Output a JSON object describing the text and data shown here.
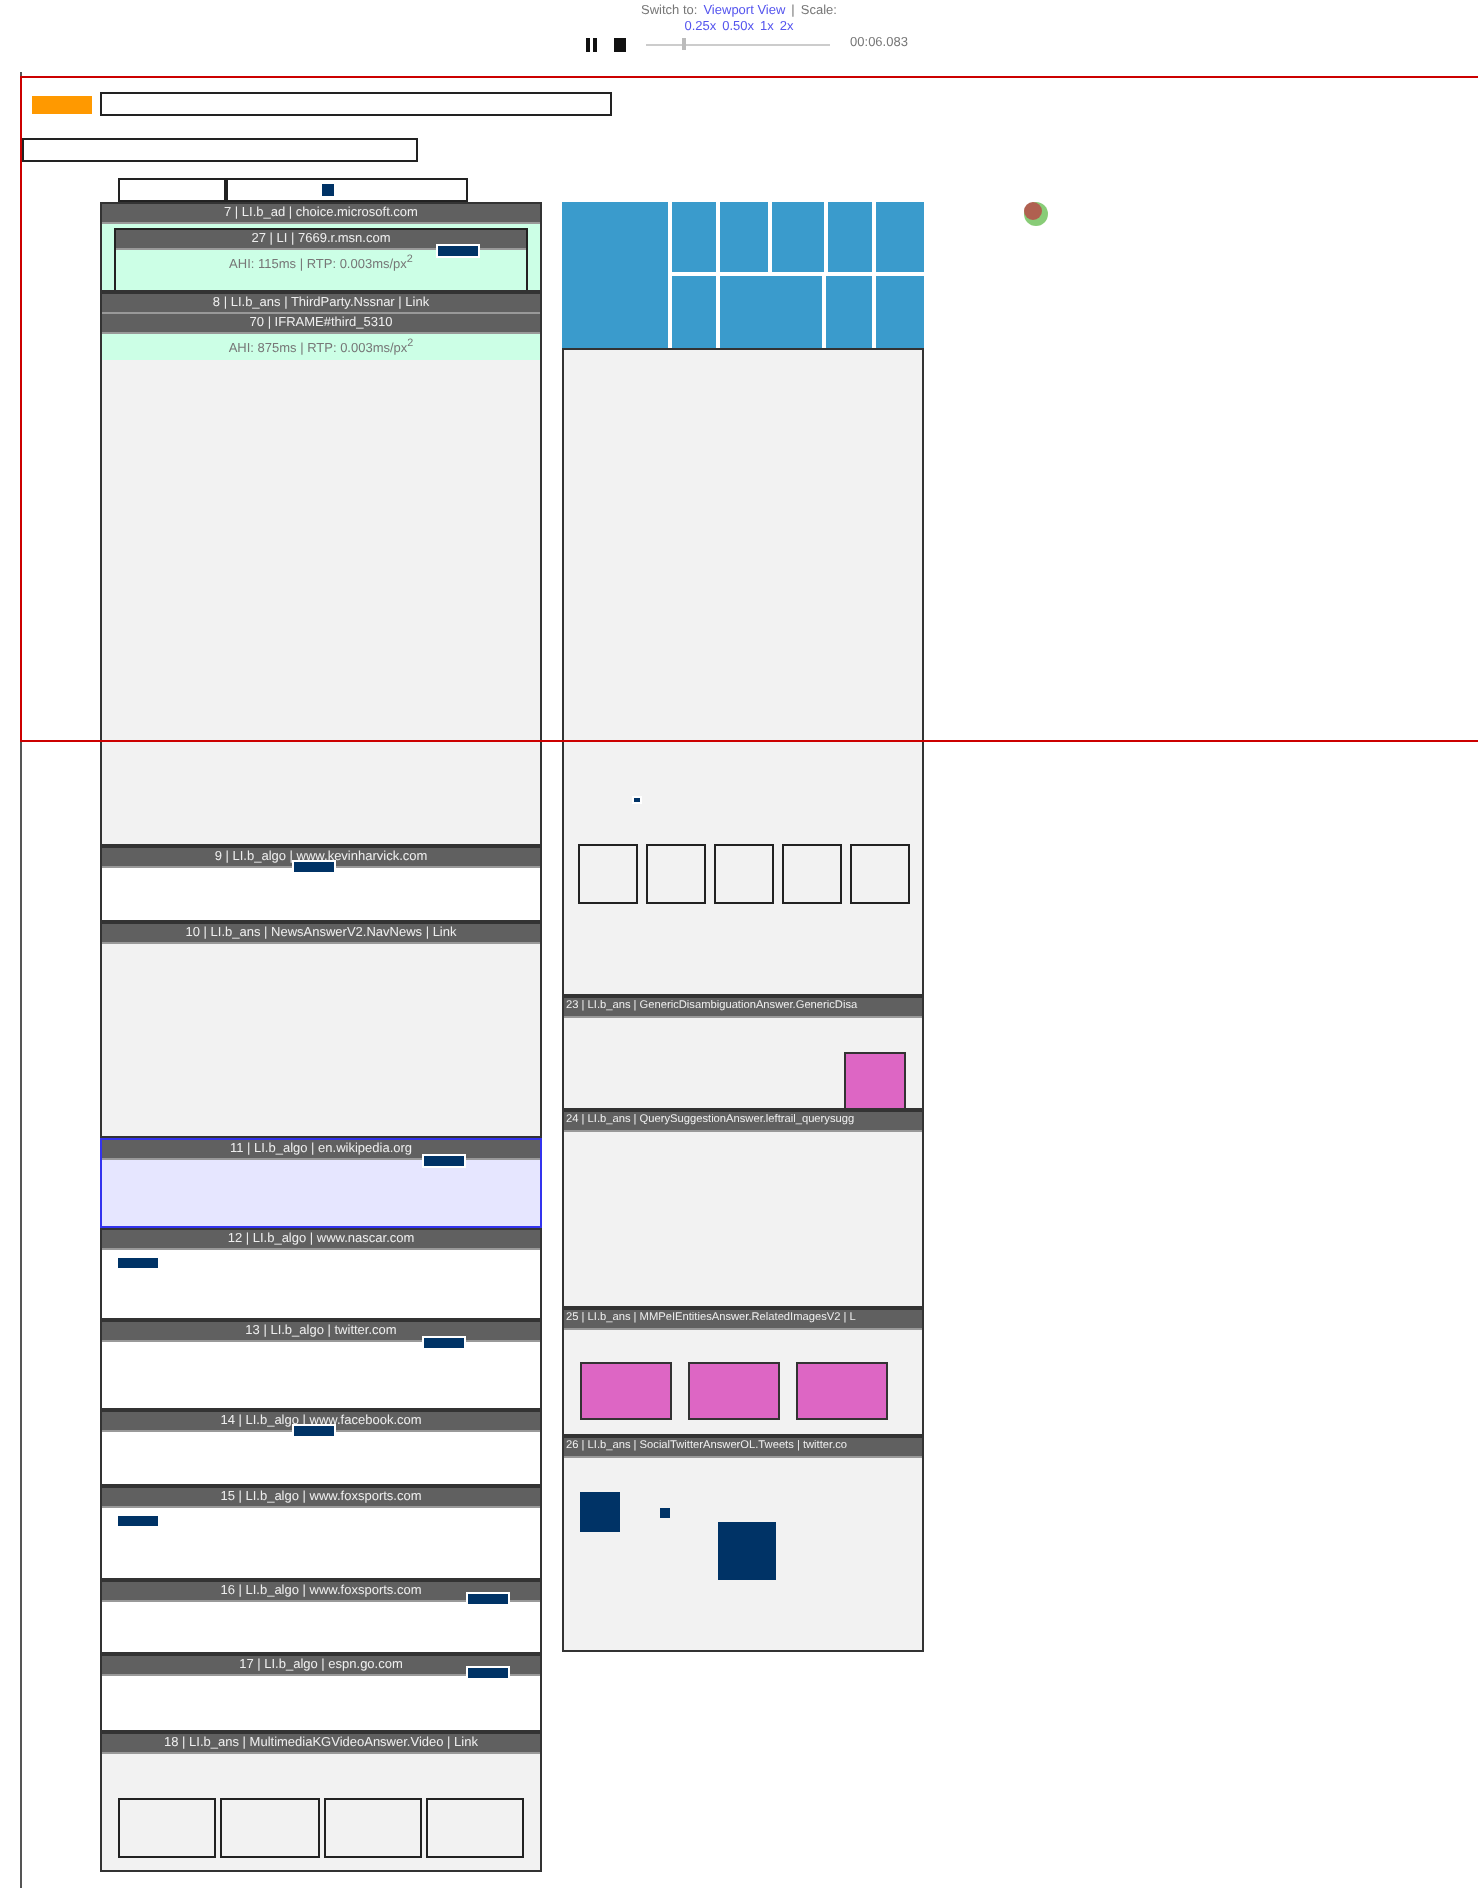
{
  "header": {
    "switch_label": "Switch to:",
    "view_link": "Viewport View",
    "separator": "|",
    "scale_label": "Scale:",
    "scales": [
      "0.25x",
      "0.50x",
      "1x",
      "2x"
    ],
    "playback": {
      "level": 0.2,
      "time": "00:06.083"
    }
  },
  "left_column": [
    {
      "title": "7 | LI.b_ad | choice.microsoft.com",
      "kind": "ad",
      "selected": false,
      "children": [
        {
          "title": "27 | LI | 7669.r.msn.com",
          "kind": "ad",
          "marker": {
            "kind": "right"
          },
          "metric": "AHI: 115ms | RTP: 0.003ms/px$^{2}$"
        }
      ]
    },
    {
      "title": "8 | LI.b_ans | ThirdParty.Nssnar | Link",
      "kind": "answer",
      "selected": false,
      "children": [
        {
          "title": "70 | IFRAME#third_5310",
          "kind": "frame",
          "metric": "AHI: 875ms | RTP: 0.003ms/px$^{2}$"
        }
      ]
    },
    {
      "title": "9 | LI.b_algo | www.kevinharvick.com",
      "kind": "result",
      "selected": false,
      "marker": {
        "kind": "center"
      }
    },
    {
      "title": "10 | LI.b_ans | NewsAnswerV2.NavNews | Link",
      "kind": "answer",
      "selected": false
    },
    {
      "title": "11 | LI.b_algo | en.wikipedia.org",
      "kind": "result",
      "selected": true,
      "marker": {
        "kind": "right"
      }
    },
    {
      "title": "12 | LI.b_algo | www.nascar.com",
      "kind": "result",
      "selected": false,
      "marker": {
        "kind": "left"
      }
    },
    {
      "title": "13 | LI.b_algo | twitter.com",
      "kind": "result",
      "selected": false,
      "marker": {
        "kind": "right"
      }
    },
    {
      "title": "14 | LI.b_algo | www.facebook.com",
      "kind": "result",
      "selected": false,
      "marker": {
        "kind": "center"
      }
    },
    {
      "title": "15 | LI.b_algo | www.foxsports.com",
      "kind": "result",
      "selected": false,
      "marker": {
        "kind": "left"
      }
    },
    {
      "title": "16 | LI.b_algo | www.foxsports.com",
      "kind": "result",
      "selected": false,
      "marker": {
        "kind": "far-right"
      }
    },
    {
      "title": "17 | LI.b_algo | espn.go.com",
      "kind": "result",
      "selected": false,
      "marker": {
        "kind": "far-right"
      }
    },
    {
      "title": "18 | LI.b_ans | MultimediaKGVideoAnswer.Video | Link",
      "kind": "answer",
      "selected": false,
      "thumbnails": [
        {
          "kind": "frame"
        },
        {
          "kind": "frame"
        },
        {
          "kind": "frame"
        },
        {
          "kind": "frame"
        }
      ]
    }
  ],
  "right_column": [
    {
      "kind": "treemap"
    },
    {
      "kind": "panel",
      "marker": {
        "kind": "left"
      },
      "thumbnails": [
        {
          "kind": "frame"
        },
        {
          "kind": "frame"
        },
        {
          "kind": "frame"
        },
        {
          "kind": "frame"
        },
        {
          "kind": "frame"
        }
      ]
    },
    {
      "title": "23 | LI.b_ans | GenericDisambiguationAnswer.GenericDisa",
      "kind": "answer",
      "thumbnails": [
        {
          "kind": "image"
        }
      ]
    },
    {
      "title": "24 | LI.b_ans | QuerySuggestionAnswer.leftrail_querysugg",
      "kind": "answer"
    },
    {
      "title": "25 | LI.b_ans | MMPeIEntitiesAnswer.RelatedImagesV2 | L",
      "kind": "answer",
      "thumbnails": [
        {
          "kind": "image"
        },
        {
          "kind": "image"
        },
        {
          "kind": "image"
        }
      ]
    },
    {
      "title": "26 | LI.b_ans | SocialTwitterAnswerOL.Tweets | twitter.co",
      "kind": "answer",
      "thumbnails": [
        {
          "kind": "tile"
        },
        {
          "kind": "dot"
        },
        {
          "kind": "tile-large"
        }
      ]
    }
  ]
}
